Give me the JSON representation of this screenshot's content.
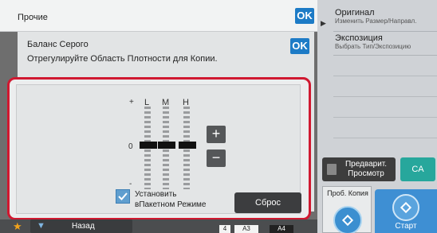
{
  "header": {
    "title": "Прочие",
    "ok_label": "OK"
  },
  "dialog": {
    "title": "Баланс Серого",
    "instruction": "Отрегулируйте Область Плотности для Копии.",
    "ok_label": "OK"
  },
  "balance": {
    "plus_sign": "+",
    "minus_sign": "-",
    "zero_label": "0",
    "columns": [
      {
        "label": "L",
        "level": 0
      },
      {
        "label": "M",
        "level": 0
      },
      {
        "label": "H",
        "level": 0
      }
    ],
    "increase_label": "+",
    "decrease_label": "−"
  },
  "batch_mode": {
    "checked": true,
    "label_line1": "Установить",
    "label_line2": "вПакетном Режиме"
  },
  "reset_label": "Сброс",
  "sidebar": {
    "items": [
      {
        "title": "Оригинал",
        "subtitle": "Изменить Размер/Направл."
      },
      {
        "title": "Экспозиция",
        "subtitle": "Выбрать Тип/Экспозицию"
      }
    ],
    "preview_line1": "Предварит.",
    "preview_line2": "Просмотр",
    "ca_label": "CA",
    "proof_copy_label": "Проб. Копия",
    "start_label": "Старт"
  },
  "bottom": {
    "back_label": "Назад",
    "paper": [
      "4",
      "A3",
      "A4"
    ]
  },
  "colors": {
    "accent_blue": "#1d7bc6",
    "highlight_red": "#d01830",
    "ca_teal": "#27a79c",
    "checkbox_blue": "#5f9ecf",
    "star_orange": "#f2a31b"
  },
  "icons": [
    "star-icon",
    "chevron-down-icon",
    "checkmark-icon",
    "diamond-icon",
    "preview-icon",
    "play-icon"
  ]
}
